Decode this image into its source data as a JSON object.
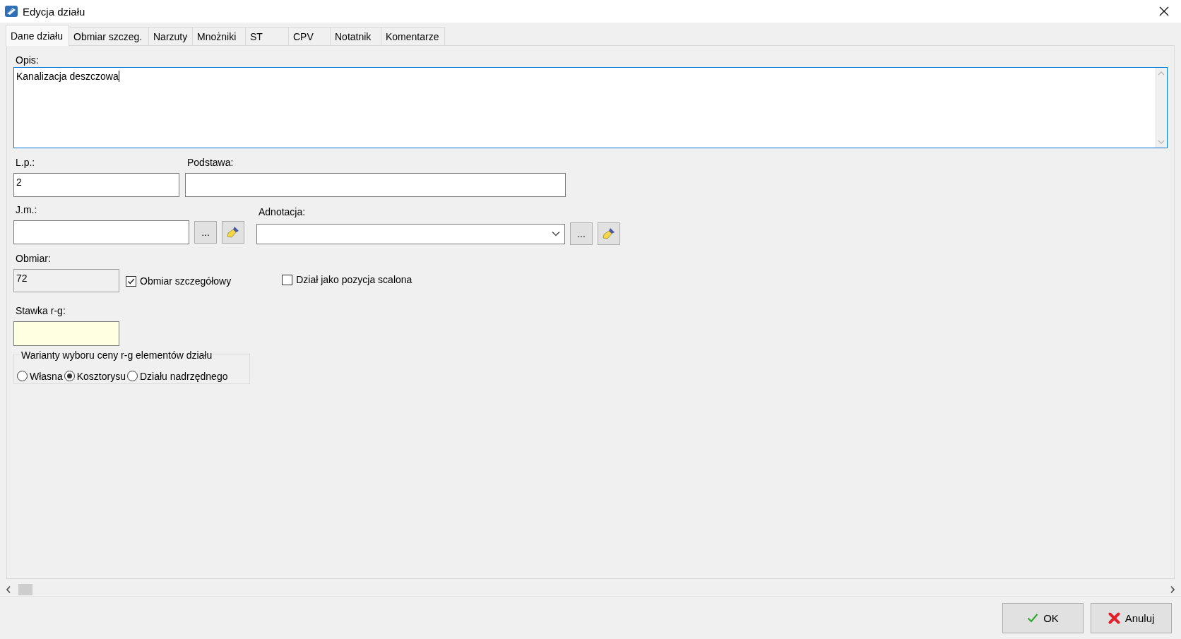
{
  "window": {
    "title": "Edycja działu"
  },
  "tabs": [
    {
      "label": "Dane działu",
      "selected": true
    },
    {
      "label": "Obmiar szczeg.",
      "selected": false
    },
    {
      "label": "Narzuty",
      "selected": false
    },
    {
      "label": "Mnożniki",
      "selected": false
    },
    {
      "label": "ST",
      "selected": false
    },
    {
      "label": "CPV",
      "selected": false
    },
    {
      "label": "Notatnik",
      "selected": false
    },
    {
      "label": "Komentarze",
      "selected": false
    }
  ],
  "description": {
    "label": "Opis:",
    "value": "Kanalizacja deszczowa",
    "focused": true
  },
  "lp": {
    "label": "L.p.:",
    "value": "2"
  },
  "podstawa": {
    "label": "Podstawa:"
  },
  "jm": {
    "label": "J.m.:",
    "browse_button": "..."
  },
  "adnotacja": {
    "label": "Adnotacja:",
    "browse_button": "..."
  },
  "obmiar": {
    "label": "Obmiar:",
    "value": "72",
    "disabled": true
  },
  "checkboxes": [
    {
      "label": "Obmiar szczegółowy",
      "checked": true
    },
    {
      "label": "Dział jako pozycja scalona",
      "checked": false
    }
  ],
  "stawka": {
    "label": "Stawka r-g:",
    "highlighted": true
  },
  "price_variants": {
    "title": "Warianty wyboru ceny r-g elementów działu",
    "options": [
      {
        "label": "Własna",
        "selected": false
      },
      {
        "label": "Kosztorysu",
        "selected": true
      },
      {
        "label": "Działu nadrzędnego",
        "selected": false
      }
    ]
  },
  "buttons": [
    {
      "kind": "ok",
      "label": "OK"
    },
    {
      "kind": "cancel",
      "label": "Anuluj"
    }
  ]
}
